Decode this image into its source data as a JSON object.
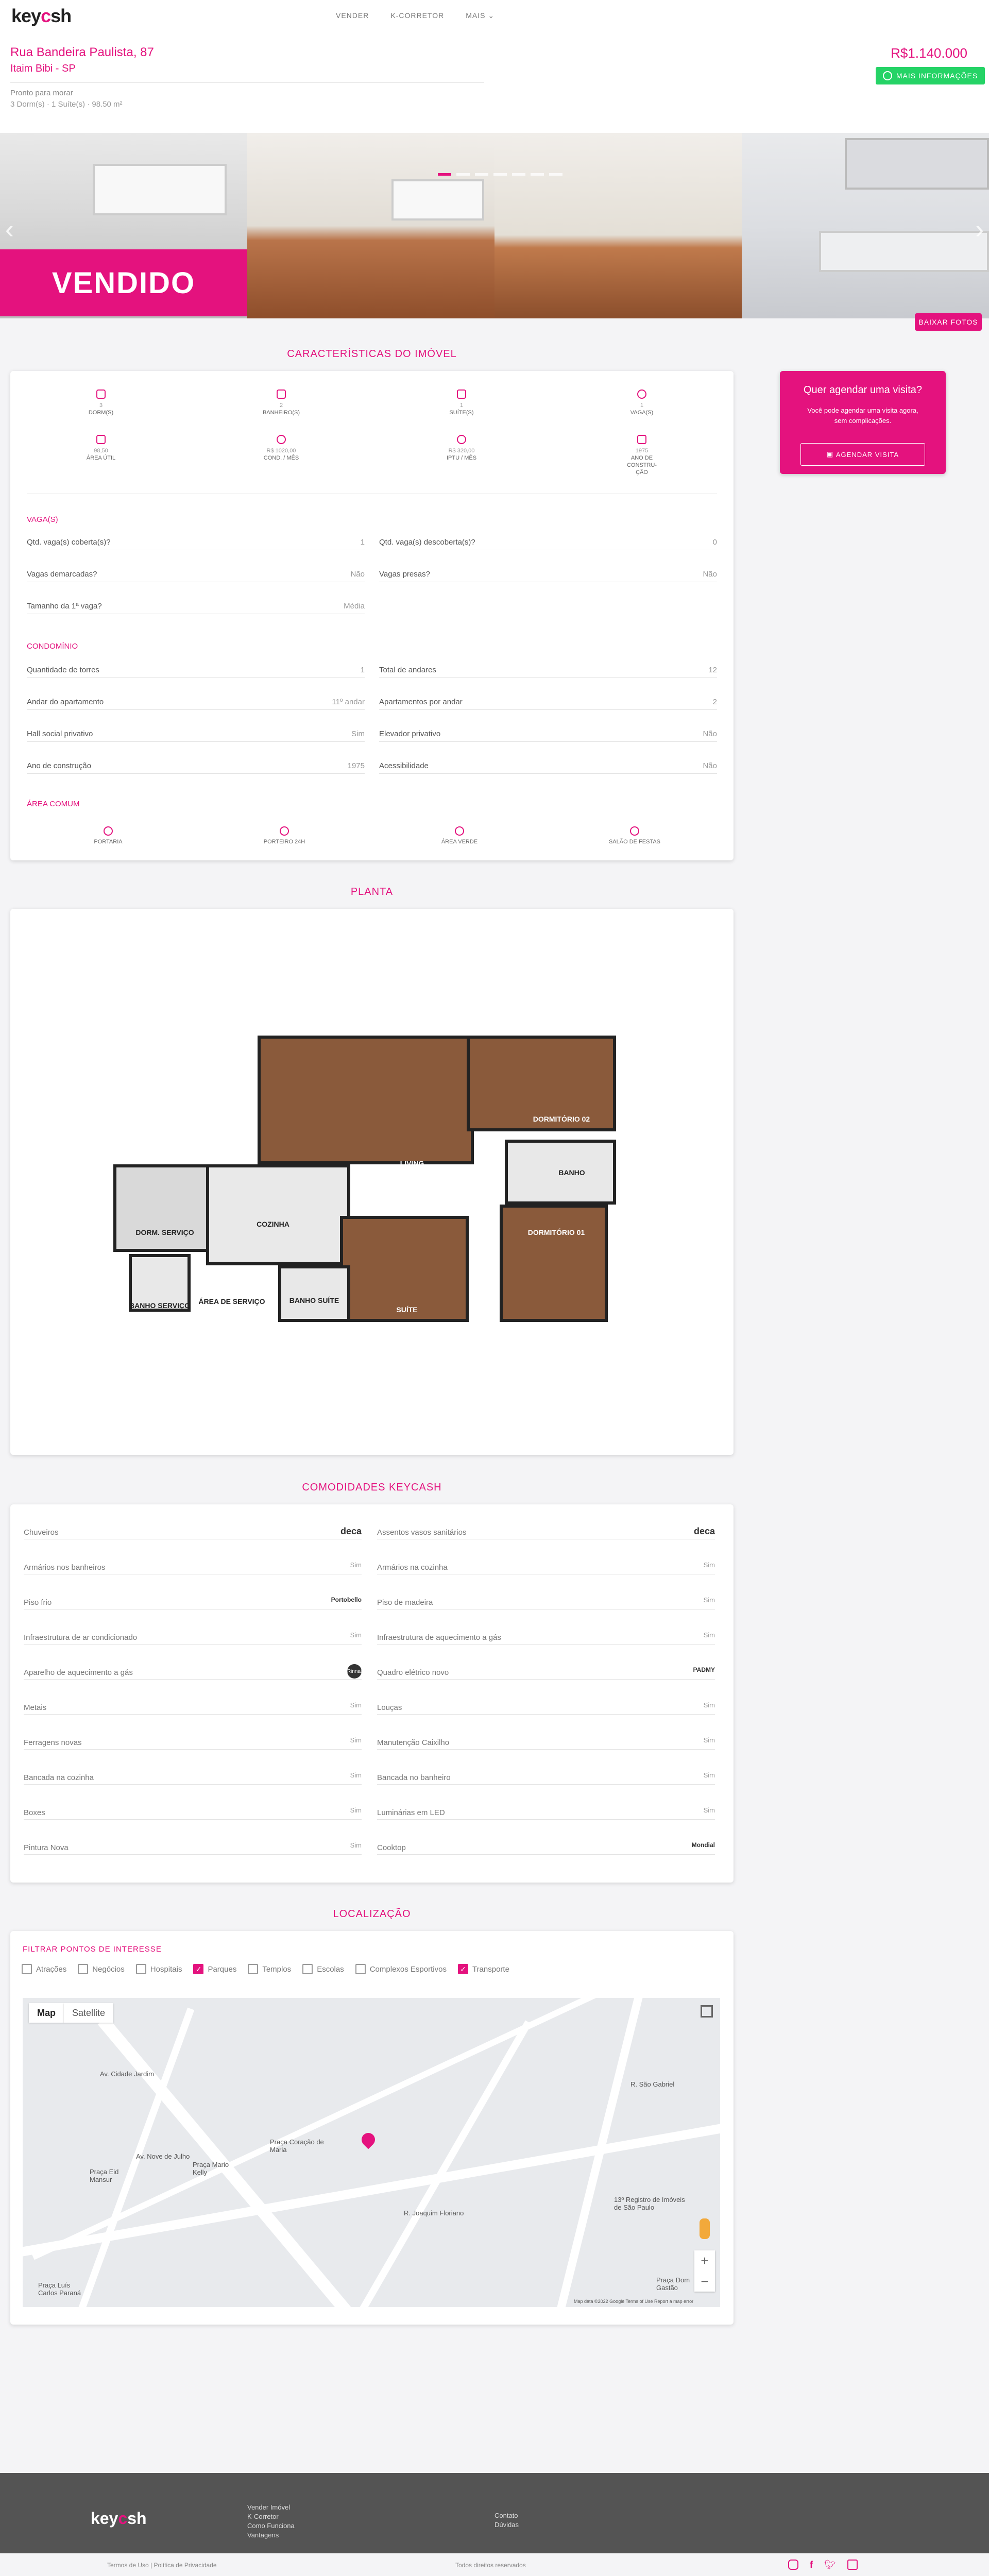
{
  "header": {
    "logo_left": "key",
    "logo_accent": "c",
    "logo_right": "sh",
    "nav": [
      "VENDER",
      "K-CORRETOR",
      "MAIS"
    ]
  },
  "property": {
    "address": "Rua Bandeira Paulista, 87",
    "neighborhood": "Itaim Bibi - SP",
    "status": "Pronto para morar",
    "summary": "3 Dorm(s) · 1 Suíte(s) · 98.50 m²",
    "price": "R$1.140.000",
    "whatsapp_label": "MAIS INFORMAÇÕES"
  },
  "gallery": {
    "sold_label": "VENDIDO",
    "prev_icon": "‹",
    "next_icon": "›",
    "download_label": "BAIXAR FOTOS",
    "active_dot": 0,
    "dot_count": 7
  },
  "characteristics": {
    "title": "CARACTERÍSTICAS DO IMÓVEL",
    "features": [
      {
        "value": "3",
        "label": "DORM(S)"
      },
      {
        "value": "2",
        "label": "BANHEIRO(S)"
      },
      {
        "value": "1",
        "label": "SUÍTE(S)"
      },
      {
        "value": "1",
        "label": "VAGA(S)"
      },
      {
        "value": "98,50",
        "label": "ÁREA ÚTIL"
      },
      {
        "value": "R$ 1020,00",
        "label": "COND. / MÊS"
      },
      {
        "value": "R$ 320,00",
        "label": "IPTU / MÊS"
      },
      {
        "value": "1975",
        "label": "ANO DE CONSTRU- ÇÃO"
      }
    ],
    "vagas_title": "VAGA(S)",
    "vagas": [
      {
        "label": "Qtd. vaga(s) coberta(s)?",
        "value": "1"
      },
      {
        "label": "Qtd. vaga(s) descoberta(s)?",
        "value": "0"
      },
      {
        "label": "Vagas demarcadas?",
        "value": "Não"
      },
      {
        "label": "Vagas presas?",
        "value": "Não"
      },
      {
        "label": "Tamanho da 1ª vaga?",
        "value": "Média"
      }
    ],
    "condo_title": "CONDOMÍNIO",
    "condo": [
      {
        "label": "Quantidade de torres",
        "value": "1"
      },
      {
        "label": "Total de andares",
        "value": "12"
      },
      {
        "label": "Andar do apartamento",
        "value": "11º andar"
      },
      {
        "label": "Apartamentos por andar",
        "value": "2"
      },
      {
        "label": "Hall social privativo",
        "value": "Sim"
      },
      {
        "label": "Elevador privativo",
        "value": "Não"
      },
      {
        "label": "Ano de construção",
        "value": "1975"
      },
      {
        "label": "Acessibilidade",
        "value": "Não"
      }
    ],
    "common_title": "ÁREA COMUM",
    "common": [
      "PORTARIA",
      "PORTEIRO 24H",
      "ÁREA VERDE",
      "SALÃO DE FESTAS"
    ]
  },
  "visit": {
    "title": "Quer agendar uma visita?",
    "subtitle": "Você pode agendar uma visita agora, sem complicações.",
    "button": "AGENDAR VISITA"
  },
  "plan": {
    "title": "PLANTA",
    "rooms": [
      "DORMITÓRIO 02",
      "LIVING",
      "BANHO",
      "DORMITÓRIO 01",
      "DORM. SERVIÇO",
      "COZINHA",
      "ÁREA DE SERVIÇO",
      "BANHO SERVIÇO",
      "BANHO SUÍTE",
      "SUÍTE"
    ]
  },
  "comodidades": {
    "title": "COMODIDADES KEYCASH",
    "items": [
      {
        "label": "Chuveiros",
        "value": "deca",
        "style": "brand"
      },
      {
        "label": "Assentos vasos sanitários",
        "value": "deca",
        "style": "brand"
      },
      {
        "label": "Armários nos banheiros",
        "value": "Sim",
        "style": ""
      },
      {
        "label": "Armários na cozinha",
        "value": "Sim",
        "style": ""
      },
      {
        "label": "Piso frio",
        "value": "Portobello",
        "style": "dark"
      },
      {
        "label": "Piso de madeira",
        "value": "Sim",
        "style": ""
      },
      {
        "label": "Infraestrutura de ar condicionado",
        "value": "Sim",
        "style": ""
      },
      {
        "label": "Infraestrutura de aquecimento a gás",
        "value": "Sim",
        "style": ""
      },
      {
        "label": "Aparelho de aquecimento a gás",
        "value": "Rinnai",
        "style": "black"
      },
      {
        "label": "Quadro elétrico novo",
        "value": "PADMY",
        "style": "dark"
      },
      {
        "label": "Metais",
        "value": "Sim",
        "style": ""
      },
      {
        "label": "Louças",
        "value": "Sim",
        "style": ""
      },
      {
        "label": "Ferragens novas",
        "value": "Sim",
        "style": ""
      },
      {
        "label": "Manutenção Caixilho",
        "value": "Sim",
        "style": ""
      },
      {
        "label": "Bancada na cozinha",
        "value": "Sim",
        "style": ""
      },
      {
        "label": "Bancada no banheiro",
        "value": "Sim",
        "style": ""
      },
      {
        "label": "Boxes",
        "value": "Sim",
        "style": ""
      },
      {
        "label": "Luminárias em LED",
        "value": "Sim",
        "style": ""
      },
      {
        "label": "Pintura Nova",
        "value": "Sim",
        "style": ""
      },
      {
        "label": "Cooktop",
        "value": "Mondial",
        "style": "dark"
      }
    ]
  },
  "location": {
    "title": "LOCALIZAÇÃO",
    "filter_title": "FILTRAR PONTOS DE INTERESSE",
    "filters": [
      {
        "label": "Atrações",
        "checked": false
      },
      {
        "label": "Negócios",
        "checked": false
      },
      {
        "label": "Hospitais",
        "checked": false
      },
      {
        "label": "Parques",
        "checked": true
      },
      {
        "label": "Templos",
        "checked": false
      },
      {
        "label": "Escolas",
        "checked": false
      },
      {
        "label": "Complexos Esportivos",
        "checked": false
      },
      {
        "label": "Transporte",
        "checked": true
      }
    ],
    "map_tab": "Map",
    "satellite_tab": "Satellite",
    "streets": [
      "Av. Nove de Julho",
      "Praça Coração de Maria",
      "Praça Mario Kelly",
      "Praça Luís Carlos Paraná",
      "R. Joaquim Floriano",
      "Av. Cidade Jardim",
      "Praça Eid Mansur",
      "13º Registro de Imóveis de São Paulo",
      "R. São Gabriel",
      "Praça Dom Gastão"
    ],
    "map_footer": "Map data ©2022 Google   Terms of Use   Report a map error"
  },
  "footer": {
    "links": [
      "Vender Imóvel",
      "K-Corretor",
      "Como Funciona",
      "Vantagens"
    ],
    "links2": [
      "Contato",
      "Dúvidas"
    ],
    "terms": "Termos de Uso | Política de Privacidade",
    "rights": "Todos direitos reservados",
    "social": [
      "instagram-icon",
      "facebook-icon",
      "twitter-icon",
      "linkedin-icon"
    ]
  }
}
